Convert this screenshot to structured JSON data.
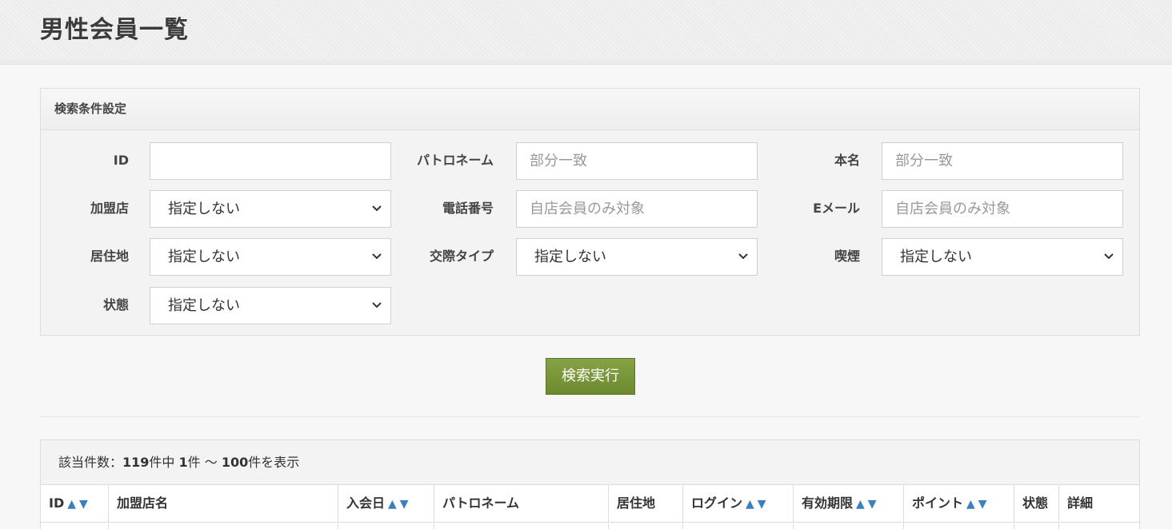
{
  "header": {
    "title": "男性会員一覧"
  },
  "search": {
    "heading": "検索条件設定",
    "fields": [
      {
        "label": "ID",
        "value": "",
        "placeholder": "",
        "type": "text"
      },
      {
        "label": "パトロネーム",
        "value": "",
        "placeholder": "部分一致",
        "type": "text"
      },
      {
        "label": "本名",
        "value": "",
        "placeholder": "部分一致",
        "type": "text"
      },
      {
        "label": "加盟店",
        "value": "指定しない",
        "type": "select"
      },
      {
        "label": "電話番号",
        "value": "",
        "placeholder": "自店会員のみ対象",
        "type": "text"
      },
      {
        "label": "Eメール",
        "value": "",
        "placeholder": "自店会員のみ対象",
        "type": "text"
      },
      {
        "label": "居住地",
        "value": "指定しない",
        "type": "select"
      },
      {
        "label": "交際タイプ",
        "value": "指定しない",
        "type": "select"
      },
      {
        "label": "喫煙",
        "value": "指定しない",
        "type": "select"
      },
      {
        "label": "状態",
        "value": "指定しない",
        "type": "select"
      }
    ],
    "submit_label": "検索実行"
  },
  "results": {
    "count_prefix": "該当件数：",
    "total": "119",
    "mid1": "件中 ",
    "from": "1",
    "mid2": "件 〜 ",
    "to": "100",
    "suffix": "件を表示",
    "sort_up": "▲",
    "sort_down": "▼",
    "columns": [
      {
        "label": "ID",
        "sortable": true
      },
      {
        "label": "加盟店名",
        "sortable": false
      },
      {
        "label": "入会日",
        "sortable": true
      },
      {
        "label": "パトロネーム",
        "sortable": false
      },
      {
        "label": "居住地",
        "sortable": false
      },
      {
        "label": "ログイン",
        "sortable": true
      },
      {
        "label": "有効期限",
        "sortable": true
      },
      {
        "label": "ポイント",
        "sortable": true
      },
      {
        "label": "状態",
        "sortable": false
      },
      {
        "label": "詳細",
        "sortable": false
      }
    ]
  },
  "colors": {
    "accent_green": "#7a9a3a",
    "sort_arrow": "#3a7fc2"
  }
}
